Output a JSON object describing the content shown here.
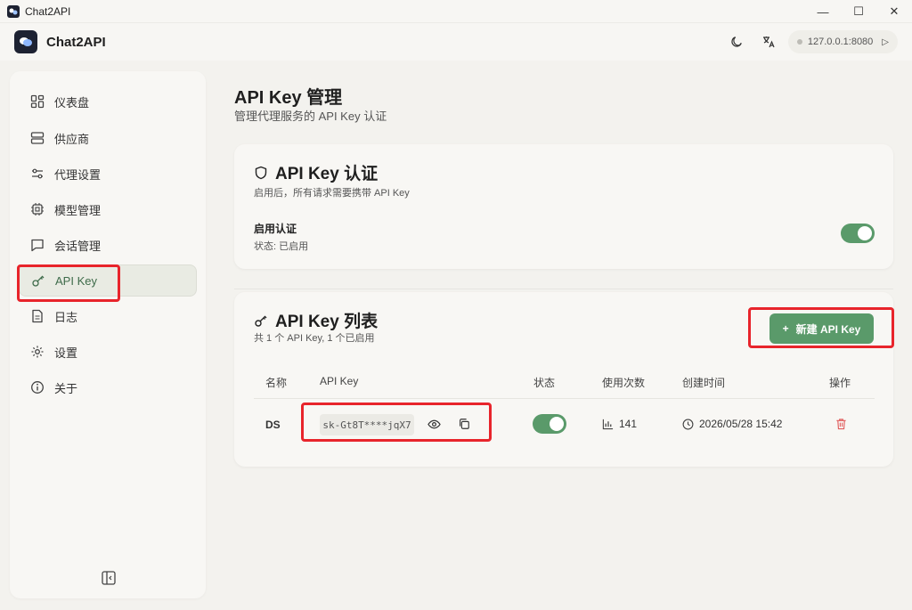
{
  "window": {
    "title": "Chat2API",
    "controls": [
      "—",
      "☐",
      "✕"
    ]
  },
  "header": {
    "app_name": "Chat2API",
    "address": "127.0.0.1:8080"
  },
  "sidebar": {
    "items": [
      {
        "label": "仪表盘",
        "icon": "dashboard-icon"
      },
      {
        "label": "供应商",
        "icon": "server-icon"
      },
      {
        "label": "代理设置",
        "icon": "sliders-icon"
      },
      {
        "label": "模型管理",
        "icon": "chip-icon"
      },
      {
        "label": "会话管理",
        "icon": "chat-icon"
      },
      {
        "label": "API Key",
        "icon": "key-icon",
        "active": true
      },
      {
        "label": "日志",
        "icon": "file-icon"
      },
      {
        "label": "设置",
        "icon": "gear-icon"
      },
      {
        "label": "关于",
        "icon": "info-icon"
      }
    ]
  },
  "page": {
    "title": "API Key 管理",
    "subtitle": "管理代理服务的 API Key 认证"
  },
  "auth_card": {
    "title": "API Key 认证",
    "subtitle": "启用后，所有请求需要携带 API Key",
    "setting_label": "启用认证",
    "status_text": "状态: 已启用",
    "enabled": true
  },
  "list_card": {
    "title": "API Key 列表",
    "subtitle": "共 1 个 API Key, 1 个已启用",
    "new_button": "新建 API Key",
    "columns": [
      "名称",
      "API Key",
      "状态",
      "使用次数",
      "创建时间",
      "操作"
    ],
    "rows": [
      {
        "name": "DS",
        "key": "sk-Gt8T****jqX7",
        "enabled": true,
        "usage": "141",
        "created": "2026/05/28 15:42"
      }
    ]
  },
  "colors": {
    "accent": "#5a9a6a",
    "highlight": "#e8242b",
    "danger": "#e05a5a"
  }
}
